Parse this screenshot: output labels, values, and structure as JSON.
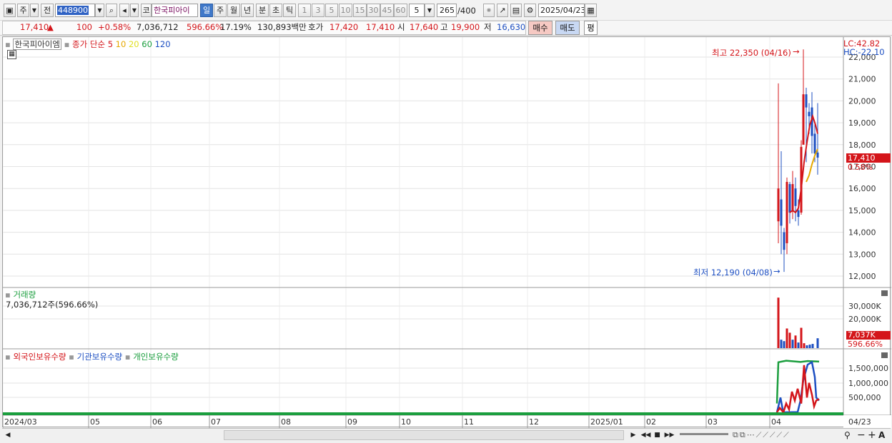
{
  "toolbar": {
    "period_label": "주",
    "prev_label": "전",
    "code_value": "448900",
    "stock_prefix": "코",
    "stock_name": "한국피아이",
    "tabs": [
      "일",
      "주",
      "월",
      "년",
      "분",
      "초",
      "틱"
    ],
    "minute_options": [
      "1",
      "3",
      "5",
      "10",
      "15",
      "30",
      "45",
      "60"
    ],
    "selected_interval": "5",
    "count_value": "265",
    "count_total": "/400",
    "date_value": "2025/04/23"
  },
  "quote": {
    "price": "17,410",
    "change_arrow": "▲",
    "change": "100",
    "change_pct": "+0.58%",
    "volume": "7,036,712",
    "volume_pct": "596.66%",
    "turnover_pct": "17.19%",
    "amount": "130,893백만",
    "hoga_label": "호가",
    "ask": "17,420",
    "bid": "17,410",
    "open_label": "시",
    "open": "17,640",
    "high_label": "고",
    "high": "19,900",
    "low_label": "저",
    "low": "16,630",
    "buy_label": "매수",
    "sell_label": "매도",
    "avg_label": "평"
  },
  "price_panel": {
    "stock_label": "한국피아이엠",
    "ma_label": "종가 단순",
    "ma_periods": [
      "5",
      "10",
      "20",
      "60",
      "120"
    ],
    "ma_colors": [
      "#d4151a",
      "#e6a800",
      "#e6e600",
      "#1b9e3e",
      "#1d4fc2"
    ],
    "lc": "LC:42.82",
    "hc": "HC:-22.10",
    "max_label": "최고 22,350 (04/16)",
    "min_label": "최저 12,190 (04/08)",
    "price_tag": "17,410",
    "price_tag_pct": "0.58%",
    "y_labels": [
      "22,000",
      "21,000",
      "20,000",
      "19,000",
      "18,000",
      "17,000",
      "16,000",
      "15,000",
      "14,000",
      "13,000",
      "12,000"
    ]
  },
  "volume_panel": {
    "title": "거래량",
    "value_text": "7,036,712주(596.66%)",
    "y_labels": [
      "30,000K",
      "20,000K"
    ],
    "tag": "7,037K",
    "tag_pct": "596.66%"
  },
  "holding_panel": {
    "series_labels": [
      "외국인보유수량",
      "기관보유수량",
      "개인보유수량"
    ],
    "series_colors": [
      "#d4151a",
      "#1d4fc2",
      "#1b9e3e"
    ],
    "y_labels": [
      "1,500,000",
      "1,000,000",
      "500,000"
    ]
  },
  "x_axis": [
    "2024/03",
    "05",
    "06",
    "07",
    "08",
    "09",
    "10",
    "11",
    "12",
    "2025/01",
    "02",
    "03",
    "04"
  ],
  "x_axis_end": "04/23"
}
